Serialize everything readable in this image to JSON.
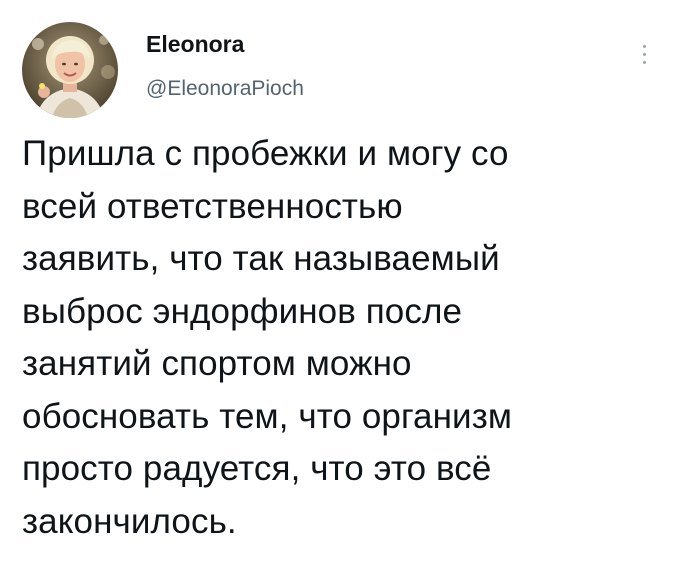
{
  "tweet": {
    "author": {
      "display_name": "Eleonora",
      "handle": "@EleonoraPioch",
      "avatar_icon": "user-avatar-photo"
    },
    "menu_icon": "more-vertical-icon",
    "text": "Пришла с пробежки и могу со\nвсей ответственностью\nзаявить, что так называемый\nвыброс эндорфинов после\nзанятий  спортом можно\nобосновать тем, что организм\nпросто радуется, что это всё\nзакончилось."
  }
}
